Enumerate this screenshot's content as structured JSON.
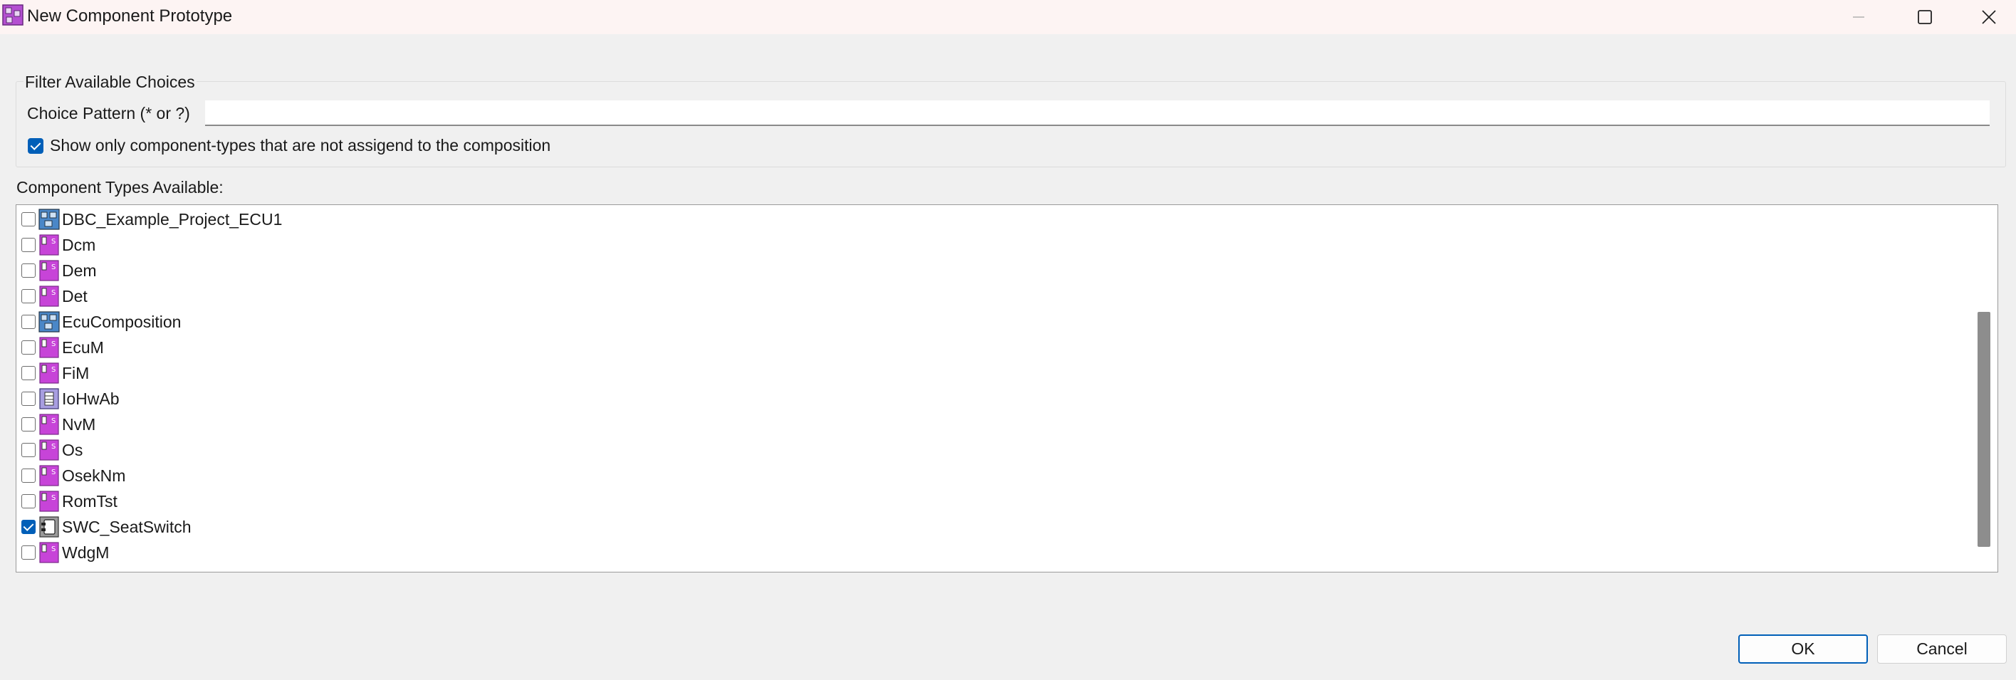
{
  "window": {
    "title": "New Component Prototype",
    "icon": "composition-icon"
  },
  "filter": {
    "legend": "Filter Available Choices",
    "pattern_label": "Choice Pattern (* or ?)",
    "pattern_value": "",
    "show_only_label": "Show only component-types that are not assigend to the composition",
    "show_only_checked": true
  },
  "component_types": {
    "label": "Component Types Available:",
    "items": [
      {
        "label": "DBC_Example_Project_ECU1",
        "icon": "composition-icon",
        "checked": false
      },
      {
        "label": "Dcm",
        "icon": "service-component-icon",
        "checked": false
      },
      {
        "label": "Dem",
        "icon": "service-component-icon",
        "checked": false
      },
      {
        "label": "Det",
        "icon": "service-component-icon",
        "checked": false
      },
      {
        "label": "EcuComposition",
        "icon": "composition-icon",
        "checked": false
      },
      {
        "label": "EcuM",
        "icon": "service-component-icon",
        "checked": false
      },
      {
        "label": "FiM",
        "icon": "service-component-icon",
        "checked": false
      },
      {
        "label": "IoHwAb",
        "icon": "ecu-abstraction-icon",
        "checked": false
      },
      {
        "label": "NvM",
        "icon": "service-component-icon",
        "checked": false
      },
      {
        "label": "Os",
        "icon": "service-component-icon",
        "checked": false
      },
      {
        "label": "OsekNm",
        "icon": "service-component-icon",
        "checked": false
      },
      {
        "label": "RomTst",
        "icon": "service-component-icon",
        "checked": false
      },
      {
        "label": "SWC_SeatSwitch",
        "icon": "application-component-icon",
        "checked": true
      },
      {
        "label": "WdgM",
        "icon": "service-component-icon",
        "checked": false
      }
    ]
  },
  "buttons": {
    "ok": "OK",
    "cancel": "Cancel"
  },
  "colors": {
    "accent": "#005fb8",
    "service_icon": "#c744d8",
    "composition_icon": "#4a87c8"
  }
}
